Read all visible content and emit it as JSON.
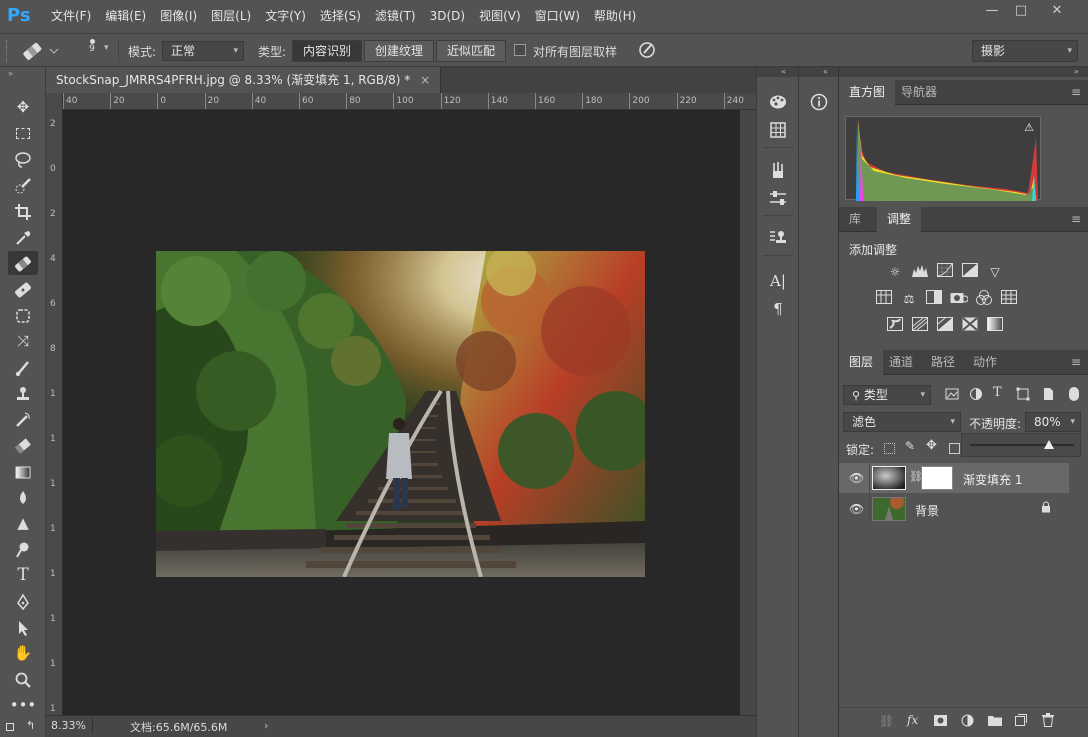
{
  "app": {
    "logo": "Ps",
    "accent": "#31a8ff"
  },
  "menubar": {
    "items": [
      "文件(F)",
      "编辑(E)",
      "图像(I)",
      "图层(L)",
      "文字(Y)",
      "选择(S)",
      "滤镜(T)",
      "3D(D)",
      "视图(V)",
      "窗口(W)",
      "帮助(H)"
    ],
    "window_controls": {
      "minimize": "—",
      "maximize": "□",
      "close": "✕"
    }
  },
  "options": {
    "brush_size": "9",
    "mode_label": "模式:",
    "mode_value": "正常",
    "type_label": "类型:",
    "type_buttons": [
      "内容识别",
      "创建纹理",
      "近似匹配"
    ],
    "sample_all_label": "对所有图层取样",
    "workspace": "摄影"
  },
  "document": {
    "tab_title": "StockSnap_JMRRS4PFRH.jpg @ 8.33% (渐变填充 1, RGB/8) *",
    "close_icon": "×",
    "ruler_h": [
      "40",
      "20",
      "0",
      "20",
      "40",
      "60",
      "80",
      "100",
      "120",
      "140",
      "160",
      "180",
      "200",
      "220",
      "240"
    ],
    "ruler_v": [
      "2",
      "0",
      "2",
      "4",
      "6",
      "8",
      "1",
      "1",
      "1",
      "1",
      "1",
      "1",
      "1",
      "1"
    ],
    "zoom": "8.33%",
    "doc_size": "文档:65.6M/65.6M",
    "status_arrow": "›"
  },
  "panels": {
    "histogram_tabs": [
      "直方图",
      "导航器"
    ],
    "adjust_tabs": [
      "库",
      "调整"
    ],
    "add_adjustment_label": "添加调整",
    "layers_tabs": [
      "图层",
      "通道",
      "路径",
      "动作"
    ],
    "filter_kind": "类型",
    "blend_mode": "滤色",
    "opacity_label": "不透明度:",
    "opacity_value": "80%",
    "lock_label": "锁定:",
    "layers": [
      {
        "name": "渐变填充 1",
        "visible": true,
        "selected": true
      },
      {
        "name": "背景",
        "visible": true,
        "locked": true
      }
    ],
    "bottom_icons": [
      "link-icon",
      "fx-icon",
      "mask-icon",
      "adjustment-icon",
      "folder-icon",
      "new-layer-icon",
      "trash-icon"
    ]
  }
}
